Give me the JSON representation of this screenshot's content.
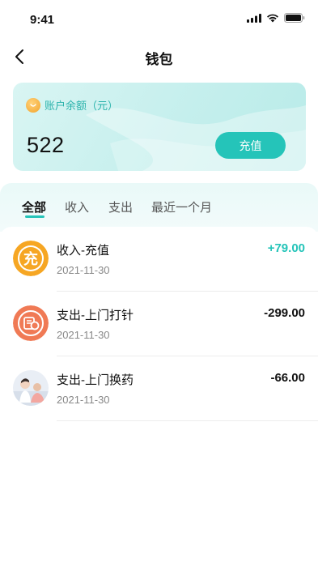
{
  "status_bar": {
    "time": "9:41"
  },
  "nav": {
    "title": "钱包"
  },
  "balance": {
    "label": "账户余额（元）",
    "amount": "522",
    "recharge_label": "充值"
  },
  "tabs": [
    {
      "label": "全部",
      "active": true
    },
    {
      "label": "收入",
      "active": false
    },
    {
      "label": "支出",
      "active": false
    },
    {
      "label": "最近一个月",
      "active": false
    }
  ],
  "transactions": [
    {
      "title": "收入-充值",
      "date": "2021-11-30",
      "amount": "+79.00",
      "type": "income",
      "icon": "recharge-icon"
    },
    {
      "title": "支出-上门打针",
      "date": "2021-11-30",
      "amount": "-299.00",
      "type": "expense",
      "icon": "injection-icon"
    },
    {
      "title": "支出-上门换药",
      "date": "2021-11-30",
      "amount": "-66.00",
      "type": "expense",
      "icon": "nurse-photo"
    }
  ],
  "colors": {
    "accent": "#25c4b9",
    "income": "#25c4b9",
    "expense": "#111111"
  }
}
